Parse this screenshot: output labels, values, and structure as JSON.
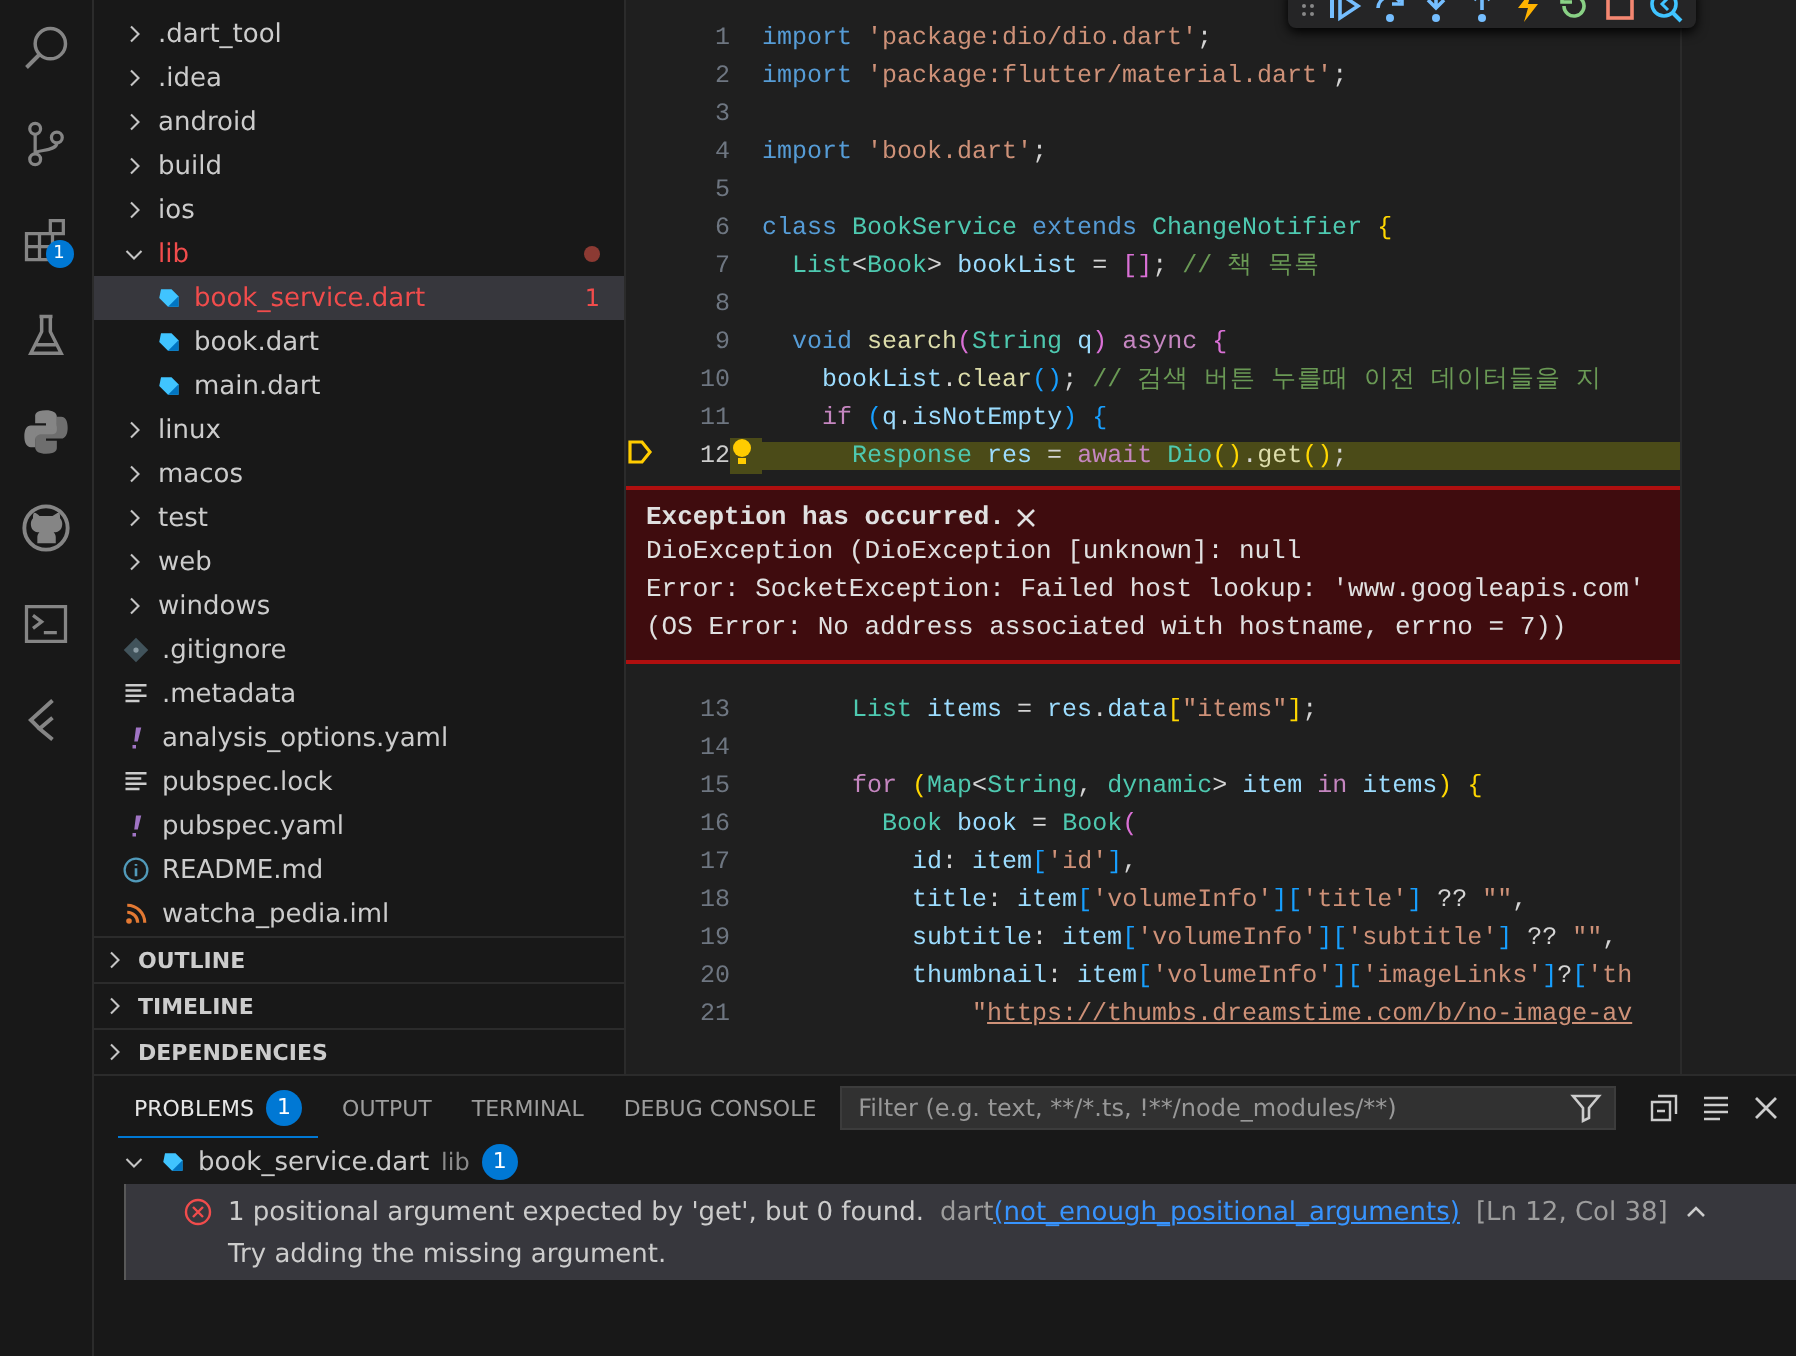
{
  "activity_bar": {
    "items": [
      {
        "kind": "search",
        "selected": false
      },
      {
        "kind": "source-control",
        "selected": false
      },
      {
        "kind": "extensions",
        "selected": false,
        "badge": "1"
      },
      {
        "kind": "testing",
        "selected": false
      },
      {
        "kind": "python",
        "selected": false
      },
      {
        "kind": "github",
        "selected": false
      },
      {
        "kind": "terminal",
        "selected": false
      },
      {
        "kind": "flutter",
        "selected": false
      }
    ]
  },
  "explorer": {
    "tree": [
      {
        "label": ".dart_tool",
        "kind": "folder",
        "expanded": false,
        "selected": false,
        "error": false
      },
      {
        "label": ".idea",
        "kind": "folder",
        "expanded": false,
        "selected": false,
        "error": false
      },
      {
        "label": "android",
        "kind": "folder",
        "expanded": false,
        "selected": false,
        "error": false
      },
      {
        "label": "build",
        "kind": "folder",
        "expanded": false,
        "selected": false,
        "error": false
      },
      {
        "label": "ios",
        "kind": "folder",
        "expanded": false,
        "selected": false,
        "error": false
      },
      {
        "label": "lib",
        "kind": "folder",
        "expanded": true,
        "selected": false,
        "error": true,
        "children": [
          {
            "label": "book_service.dart",
            "kind": "dart",
            "selected": true,
            "error": true,
            "badge": "1"
          },
          {
            "label": "book.dart",
            "kind": "dart",
            "selected": false,
            "error": false
          },
          {
            "label": "main.dart",
            "kind": "dart",
            "selected": false,
            "error": false
          }
        ]
      },
      {
        "label": "linux",
        "kind": "folder",
        "expanded": false,
        "selected": false,
        "error": false
      },
      {
        "label": "macos",
        "kind": "folder",
        "expanded": false,
        "selected": false,
        "error": false
      },
      {
        "label": "test",
        "kind": "folder",
        "expanded": false,
        "selected": false,
        "error": false
      },
      {
        "label": "web",
        "kind": "folder",
        "expanded": false,
        "selected": false,
        "error": false
      },
      {
        "label": "windows",
        "kind": "folder",
        "expanded": false,
        "selected": false,
        "error": false
      },
      {
        "label": ".gitignore",
        "kind": "git",
        "selected": false,
        "error": false
      },
      {
        "label": ".metadata",
        "kind": "text",
        "selected": false,
        "error": false
      },
      {
        "label": "analysis_options.yaml",
        "kind": "yaml",
        "selected": false,
        "error": false
      },
      {
        "label": "pubspec.lock",
        "kind": "text",
        "selected": false,
        "error": false
      },
      {
        "label": "pubspec.yaml",
        "kind": "yaml",
        "selected": false,
        "error": false
      },
      {
        "label": "README.md",
        "kind": "info",
        "selected": false,
        "error": false
      },
      {
        "label": "watcha_pedia.iml",
        "kind": "feed",
        "selected": false,
        "error": false
      }
    ],
    "sections": [
      {
        "label": "OUTLINE",
        "expanded": false
      },
      {
        "label": "TIMELINE",
        "expanded": false
      },
      {
        "label": "DEPENDENCIES",
        "expanded": false
      }
    ]
  },
  "editor": {
    "lines": [
      {
        "number": "1",
        "current": false,
        "tokens": [
          {
            "text": "import ",
            "kind": "kw"
          },
          {
            "text": "'package:dio/dio.dart'",
            "kind": "str"
          },
          {
            "text": ";",
            "kind": "p"
          }
        ]
      },
      {
        "number": "2",
        "current": false,
        "tokens": [
          {
            "text": "import ",
            "kind": "kw"
          },
          {
            "text": "'package:flutter/material.dart'",
            "kind": "str"
          },
          {
            "text": ";",
            "kind": "p"
          }
        ]
      },
      {
        "number": "3",
        "current": false
      },
      {
        "number": "4",
        "current": false,
        "tokens": [
          {
            "text": "import ",
            "kind": "kw"
          },
          {
            "text": "'book.dart'",
            "kind": "str"
          },
          {
            "text": ";",
            "kind": "p"
          }
        ]
      },
      {
        "number": "5",
        "current": false
      },
      {
        "number": "6",
        "current": false,
        "tokens": [
          {
            "text": "class ",
            "kind": "kw"
          },
          {
            "text": "BookService ",
            "kind": "type"
          },
          {
            "text": "extends ",
            "kind": "kw"
          },
          {
            "text": "ChangeNotifier ",
            "kind": "type"
          },
          {
            "text": "{",
            "kind": "b1"
          }
        ]
      },
      {
        "number": "7",
        "current": false,
        "tokens": [
          {
            "text": "  List",
            "kind": "type"
          },
          {
            "text": "<",
            "kind": "p"
          },
          {
            "text": "Book",
            "kind": "type"
          },
          {
            "text": "> ",
            "kind": "p"
          },
          {
            "text": "bookList",
            "kind": "var"
          },
          {
            "text": " = ",
            "kind": "p"
          },
          {
            "text": "[]",
            "kind": "b2"
          },
          {
            "text": "; ",
            "kind": "p"
          },
          {
            "text": "// 책 목록",
            "kind": "com"
          }
        ]
      },
      {
        "number": "8",
        "current": false
      },
      {
        "number": "9",
        "current": false,
        "tokens": [
          {
            "text": "  void ",
            "kind": "kw"
          },
          {
            "text": "search",
            "kind": "fn"
          },
          {
            "text": "(",
            "kind": "b2"
          },
          {
            "text": "String ",
            "kind": "type"
          },
          {
            "text": "q",
            "kind": "var"
          },
          {
            "text": ") ",
            "kind": "b2"
          },
          {
            "text": "async ",
            "kind": "ctl"
          },
          {
            "text": "{",
            "kind": "b2"
          }
        ]
      },
      {
        "number": "10",
        "current": false,
        "tokens": [
          {
            "text": "    bookList",
            "kind": "var"
          },
          {
            "text": ".",
            "kind": "p"
          },
          {
            "text": "clear",
            "kind": "fn"
          },
          {
            "text": "()",
            "kind": "b3"
          },
          {
            "text": "; ",
            "kind": "p"
          },
          {
            "text": "// 검색 버튼 누를때 이전 데이터들을 지",
            "kind": "com"
          }
        ]
      },
      {
        "number": "11",
        "current": false,
        "tokens": [
          {
            "text": "    if ",
            "kind": "ctl"
          },
          {
            "text": "(",
            "kind": "b3"
          },
          {
            "text": "q",
            "kind": "var"
          },
          {
            "text": ".",
            "kind": "p"
          },
          {
            "text": "isNotEmpty",
            "kind": "var"
          },
          {
            "text": ") ",
            "kind": "b3"
          },
          {
            "text": "{",
            "kind": "b3"
          }
        ]
      },
      {
        "number": "12",
        "current": true,
        "tokens": [
          {
            "text": "      Response ",
            "kind": "type"
          },
          {
            "text": "res",
            "kind": "var"
          },
          {
            "text": " = ",
            "kind": "p"
          },
          {
            "text": "await ",
            "kind": "ctl"
          },
          {
            "text": "Dio",
            "kind": "type"
          },
          {
            "text": "()",
            "kind": "b1"
          },
          {
            "text": ".",
            "kind": "p"
          },
          {
            "text": "get",
            "kind": "fn"
          },
          {
            "text": "()",
            "kind": "b1"
          },
          {
            "text": ";",
            "kind": "p"
          }
        ],
        "exception": {
          "title": "Exception has occurred.",
          "lines": [
            "DioException (DioException [unknown]: null",
            "Error: SocketException: Failed host lookup: 'www.googleapis.com'",
            "(OS Error: No address associated with hostname, errno = 7))"
          ]
        }
      },
      {
        "number": "13",
        "current": false,
        "tokens": [
          {
            "text": "      List ",
            "kind": "type"
          },
          {
            "text": "items",
            "kind": "var"
          },
          {
            "text": " = ",
            "kind": "p"
          },
          {
            "text": "res",
            "kind": "var"
          },
          {
            "text": ".",
            "kind": "p"
          },
          {
            "text": "data",
            "kind": "var"
          },
          {
            "text": "[",
            "kind": "b1"
          },
          {
            "text": "\"items\"",
            "kind": "str"
          },
          {
            "text": "]",
            "kind": "b1"
          },
          {
            "text": ";",
            "kind": "p"
          }
        ]
      },
      {
        "number": "14",
        "current": false
      },
      {
        "number": "15",
        "current": false,
        "tokens": [
          {
            "text": "      for ",
            "kind": "ctl"
          },
          {
            "text": "(",
            "kind": "b1"
          },
          {
            "text": "Map",
            "kind": "type"
          },
          {
            "text": "<",
            "kind": "p"
          },
          {
            "text": "String",
            "kind": "type"
          },
          {
            "text": ", ",
            "kind": "p"
          },
          {
            "text": "dynamic",
            "kind": "type"
          },
          {
            "text": "> ",
            "kind": "p"
          },
          {
            "text": "item ",
            "kind": "var"
          },
          {
            "text": "in ",
            "kind": "ctl"
          },
          {
            "text": "items",
            "kind": "var"
          },
          {
            "text": ") ",
            "kind": "b1"
          },
          {
            "text": "{",
            "kind": "b1"
          }
        ]
      },
      {
        "number": "16",
        "current": false,
        "tokens": [
          {
            "text": "        Book ",
            "kind": "type"
          },
          {
            "text": "book",
            "kind": "var"
          },
          {
            "text": " = ",
            "kind": "p"
          },
          {
            "text": "Book",
            "kind": "type"
          },
          {
            "text": "(",
            "kind": "b2"
          }
        ]
      },
      {
        "number": "17",
        "current": false,
        "tokens": [
          {
            "text": "          id",
            "kind": "var"
          },
          {
            "text": ": ",
            "kind": "p"
          },
          {
            "text": "item",
            "kind": "var"
          },
          {
            "text": "[",
            "kind": "b3"
          },
          {
            "text": "'id'",
            "kind": "str"
          },
          {
            "text": "]",
            "kind": "b3"
          },
          {
            "text": ",",
            "kind": "p"
          }
        ]
      },
      {
        "number": "18",
        "current": false,
        "tokens": [
          {
            "text": "          title",
            "kind": "var"
          },
          {
            "text": ": ",
            "kind": "p"
          },
          {
            "text": "item",
            "kind": "var"
          },
          {
            "text": "[",
            "kind": "b3"
          },
          {
            "text": "'volumeInfo'",
            "kind": "str"
          },
          {
            "text": "][",
            "kind": "b3"
          },
          {
            "text": "'title'",
            "kind": "str"
          },
          {
            "text": "]",
            "kind": "b3"
          },
          {
            "text": " ?? ",
            "kind": "p"
          },
          {
            "text": "\"\"",
            "kind": "str"
          },
          {
            "text": ",",
            "kind": "p"
          }
        ]
      },
      {
        "number": "19",
        "current": false,
        "tokens": [
          {
            "text": "          subtitle",
            "kind": "var"
          },
          {
            "text": ": ",
            "kind": "p"
          },
          {
            "text": "item",
            "kind": "var"
          },
          {
            "text": "[",
            "kind": "b3"
          },
          {
            "text": "'volumeInfo'",
            "kind": "str"
          },
          {
            "text": "][",
            "kind": "b3"
          },
          {
            "text": "'subtitle'",
            "kind": "str"
          },
          {
            "text": "]",
            "kind": "b3"
          },
          {
            "text": " ?? ",
            "kind": "p"
          },
          {
            "text": "\"\"",
            "kind": "str"
          },
          {
            "text": ",",
            "kind": "p"
          }
        ]
      },
      {
        "number": "20",
        "current": false,
        "tokens": [
          {
            "text": "          thumbnail",
            "kind": "var"
          },
          {
            "text": ": ",
            "kind": "p"
          },
          {
            "text": "item",
            "kind": "var"
          },
          {
            "text": "[",
            "kind": "b3"
          },
          {
            "text": "'volumeInfo'",
            "kind": "str"
          },
          {
            "text": "][",
            "kind": "b3"
          },
          {
            "text": "'imageLinks'",
            "kind": "str"
          },
          {
            "text": "]",
            "kind": "b3"
          },
          {
            "text": "?",
            "kind": "p"
          },
          {
            "text": "[",
            "kind": "b3"
          },
          {
            "text": "'th",
            "kind": "str"
          }
        ]
      },
      {
        "number": "21",
        "current": false,
        "tokens": [
          {
            "text": "              \"",
            "kind": "str"
          },
          {
            "text": "https://thumbs.dreamstime.com/b/no-image-av",
            "kind": "link"
          }
        ]
      }
    ]
  },
  "debug_toolbar": {
    "buttons": [
      {
        "kind": "continue"
      },
      {
        "kind": "step-over"
      },
      {
        "kind": "step-into"
      },
      {
        "kind": "step-out"
      },
      {
        "kind": "hot-reload"
      },
      {
        "kind": "restart"
      },
      {
        "kind": "stop"
      },
      {
        "kind": "inspect"
      }
    ]
  },
  "panel": {
    "tabs": [
      {
        "label": "PROBLEMS",
        "selected": true,
        "badge": "1"
      },
      {
        "label": "OUTPUT",
        "selected": false
      },
      {
        "label": "TERMINAL",
        "selected": false
      },
      {
        "label": "DEBUG CONSOLE",
        "selected": false
      }
    ],
    "filter": {
      "placeholder": "Filter (e.g. text, **/*.ts, !**/node_modules/**)"
    },
    "groups": [
      {
        "file": "book_service.dart",
        "folder": "lib",
        "count": "1",
        "expanded": true,
        "problems": [
          {
            "message": "1 positional argument expected by 'get', but 0 found.",
            "source": "dart",
            "code": "(not_enough_positional_arguments)",
            "location": "[Ln 12, Col 38]",
            "hint": "Try adding the missing argument.",
            "selected": true
          }
        ]
      }
    ]
  }
}
